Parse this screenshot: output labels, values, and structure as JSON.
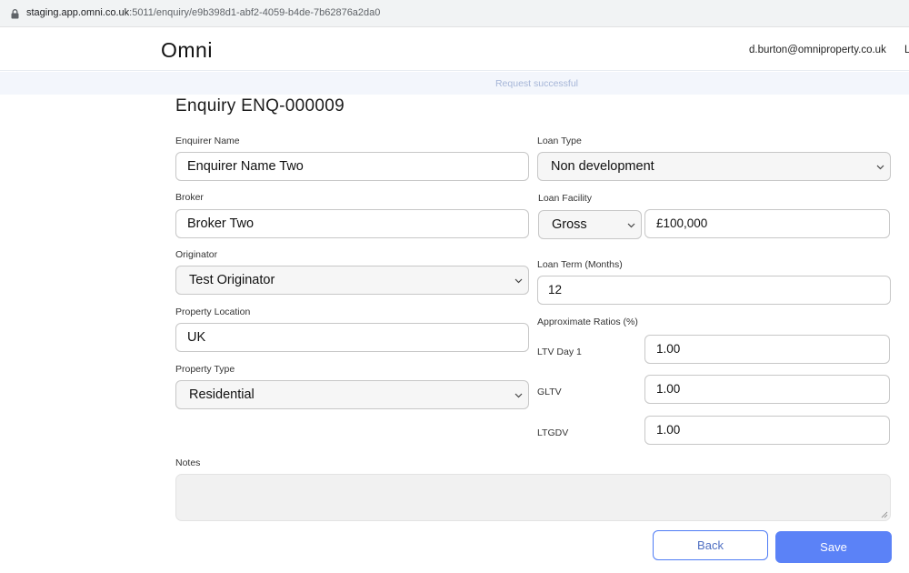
{
  "browser": {
    "url_host": "staging.app.omni.co.uk",
    "url_rest": ":5011/enquiry/e9b398d1-abf2-4059-b4de-7b62876a2da0"
  },
  "nav": {
    "brand": "Omni",
    "user_email": "d.burton@omniproperty.co.uk",
    "clipped_text": "L"
  },
  "alert": {
    "message": "Request successful"
  },
  "page": {
    "title": "Enquiry ENQ-000009"
  },
  "form": {
    "enquirer_name": {
      "label": "Enquirer Name",
      "value": "Enquirer Name Two"
    },
    "broker": {
      "label": "Broker",
      "value": "Broker Two"
    },
    "originator": {
      "label": "Originator",
      "value": "Test Originator"
    },
    "property_location": {
      "label": "Property Location",
      "value": "UK"
    },
    "property_type": {
      "label": "Property Type",
      "value": "Residential"
    },
    "loan_type": {
      "label": "Loan Type",
      "value": "Non development"
    },
    "loan_facility": {
      "label": "Loan Facility",
      "basis": "Gross",
      "amount": "£100,000"
    },
    "loan_term": {
      "label": "Loan Term (Months)",
      "value": "12"
    },
    "ratios": {
      "label": "Approximate Ratios (%)",
      "ltv_day1": {
        "label": "LTV Day 1",
        "value": "1.00"
      },
      "gltv": {
        "label": "GLTV",
        "value": "1.00"
      },
      "ltgdv": {
        "label": "LTGDV",
        "value": "1.00"
      }
    },
    "notes": {
      "label": "Notes",
      "value": ""
    }
  },
  "actions": {
    "back_label": "Back",
    "save_label": "Save"
  },
  "colors": {
    "primary": "#5b82f7",
    "alert_bg": "#f3f6fc",
    "alert_text": "#a6b6d8",
    "select_bg": "#f6f6f6"
  }
}
